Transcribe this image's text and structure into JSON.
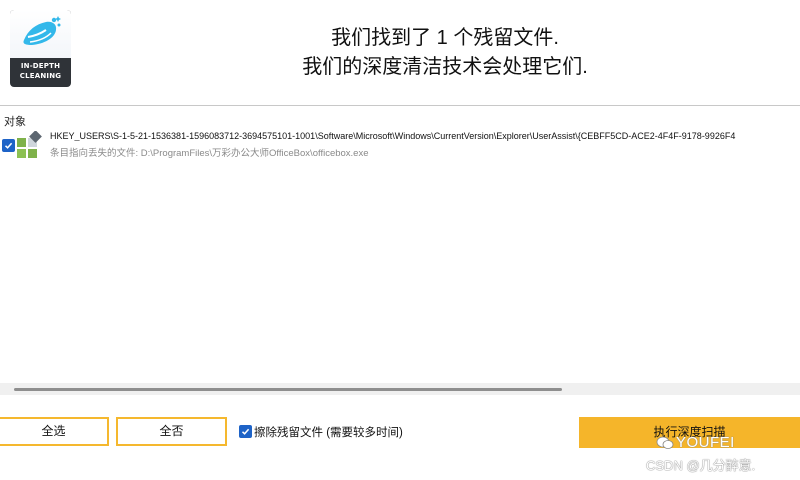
{
  "header": {
    "logo_text": "IN-DEPTH CLEANING",
    "headline_line1": "我们找到了 1 个残留文件.",
    "headline_line2": "我们的深度清洁技术会处理它们."
  },
  "list": {
    "column_header": "对象",
    "items": [
      {
        "checked": true,
        "icon": "registry-icon",
        "path": "HKEY_USERS\\S-1-5-21-1536381-1596083712-3694575101-1001\\Software\\Microsoft\\Windows\\CurrentVersion\\Explorer\\UserAssist\\{CEBFF5CD-ACE2-4F4F-9178-9926F4",
        "description": "条目指向丢失的文件: D:\\ProgramFiles\\万彩办公大师OfficeBox\\officebox.exe"
      }
    ]
  },
  "footer": {
    "select_all_label": "全选",
    "select_none_label": "全否",
    "erase_option_label": "擦除残留文件 (需要较多时间)",
    "erase_option_checked": true,
    "primary_button_label": "执行深度扫描"
  },
  "watermark": {
    "line1": "YOUFEI",
    "line2": "CSDN @几分醉意."
  },
  "colors": {
    "accent": "#f5b52a",
    "checkbox": "#1e63c7",
    "logo_bg": "#2f3338"
  }
}
